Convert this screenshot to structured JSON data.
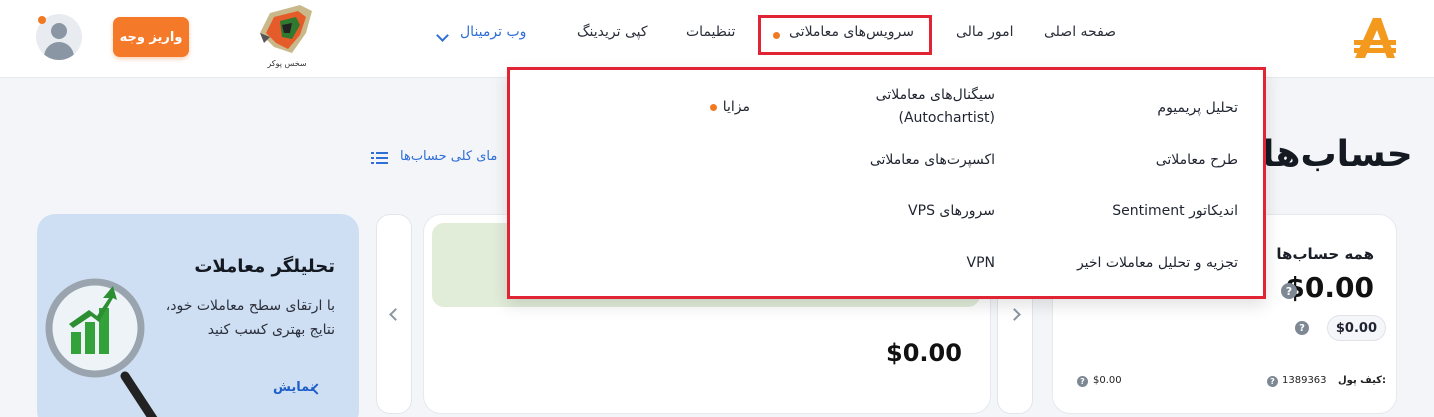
{
  "header": {
    "deposit_label": "واریز وجه",
    "partner_caption": "سخس پوکر",
    "nav": {
      "home": "صفحه اصلی",
      "finance": "امور مالی",
      "trading_services": "سرویس‌های معاملاتی",
      "settings": "تنظیمات",
      "copy_trading": "کپی تریدینگ",
      "web_terminal": "وب ترمینال"
    }
  },
  "dropdown": {
    "col1": [
      "تحلیل پریمیوم",
      "طرح معاملاتی",
      "اندیکاتور Sentiment",
      "تجزیه و تحلیل معاملات اخیر"
    ],
    "col2": [
      "سیگنال‌های معاملاتی",
      "اکسپرت‌های معاملاتی",
      "سرورهای VPS",
      "VPN"
    ],
    "col2_sub": "(Autochartist)",
    "col3": [
      "مزایا"
    ]
  },
  "page": {
    "title": "حساب‌ها",
    "list_link": "مای کلی حساب‌ها"
  },
  "analyzer": {
    "title": "تحلیلگر معاملات",
    "text": "با ارتقای سطح معاملات خود، نتایج بهتری کسب کنید",
    "link": "نمایش"
  },
  "middle_card": {
    "value": "$0.00"
  },
  "accounts_card": {
    "title": "همه حساب‌ها",
    "total": "$0.00",
    "pill_value": "$0.00",
    "wallet_label": "کیف پول:",
    "wallet_id": "1389363",
    "wallet_value": "$0.00",
    "help": "?"
  },
  "colors": {
    "accent": "#f47a2a",
    "link": "#2f6fd6",
    "highlight": "#e12434",
    "analyzer_bg": "#cfdff3"
  }
}
